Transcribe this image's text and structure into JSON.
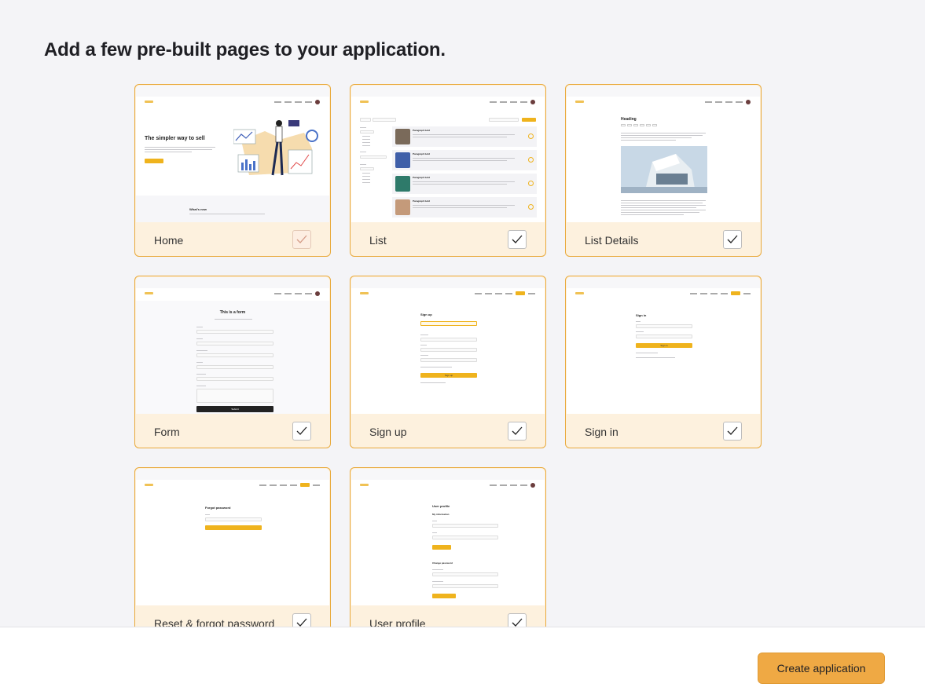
{
  "heading": "Add a few pre-built pages to your application.",
  "pages": [
    {
      "label": "Home",
      "checked": true
    },
    {
      "label": "List",
      "checked": true
    },
    {
      "label": "List Details",
      "checked": true
    },
    {
      "label": "Form",
      "checked": true
    },
    {
      "label": "Sign up",
      "checked": true
    },
    {
      "label": "Sign in",
      "checked": true
    },
    {
      "label": "Reset & forgot password",
      "checked": true
    },
    {
      "label": "User profile",
      "checked": true
    }
  ],
  "previews": {
    "home_title": "The simpler way to sell",
    "home_whats_new": "What's new",
    "list_item_title": "Paragraph bold",
    "details_heading": "Heading",
    "form_title": "This is a form",
    "form_submit": "Submit",
    "signup_title": "Sign up",
    "signup_button": "Sign up",
    "signin_title": "Sign in",
    "signin_button": "Sign in",
    "forgot_title": "Forgot password",
    "profile_title": "User profile",
    "profile_section_info": "My information",
    "profile_section_password": "Change password"
  },
  "footer": {
    "create_button": "Create application"
  },
  "colors": {
    "accent": "#efa944",
    "card_border": "#e9a93a",
    "card_bg": "#fdf1de"
  }
}
